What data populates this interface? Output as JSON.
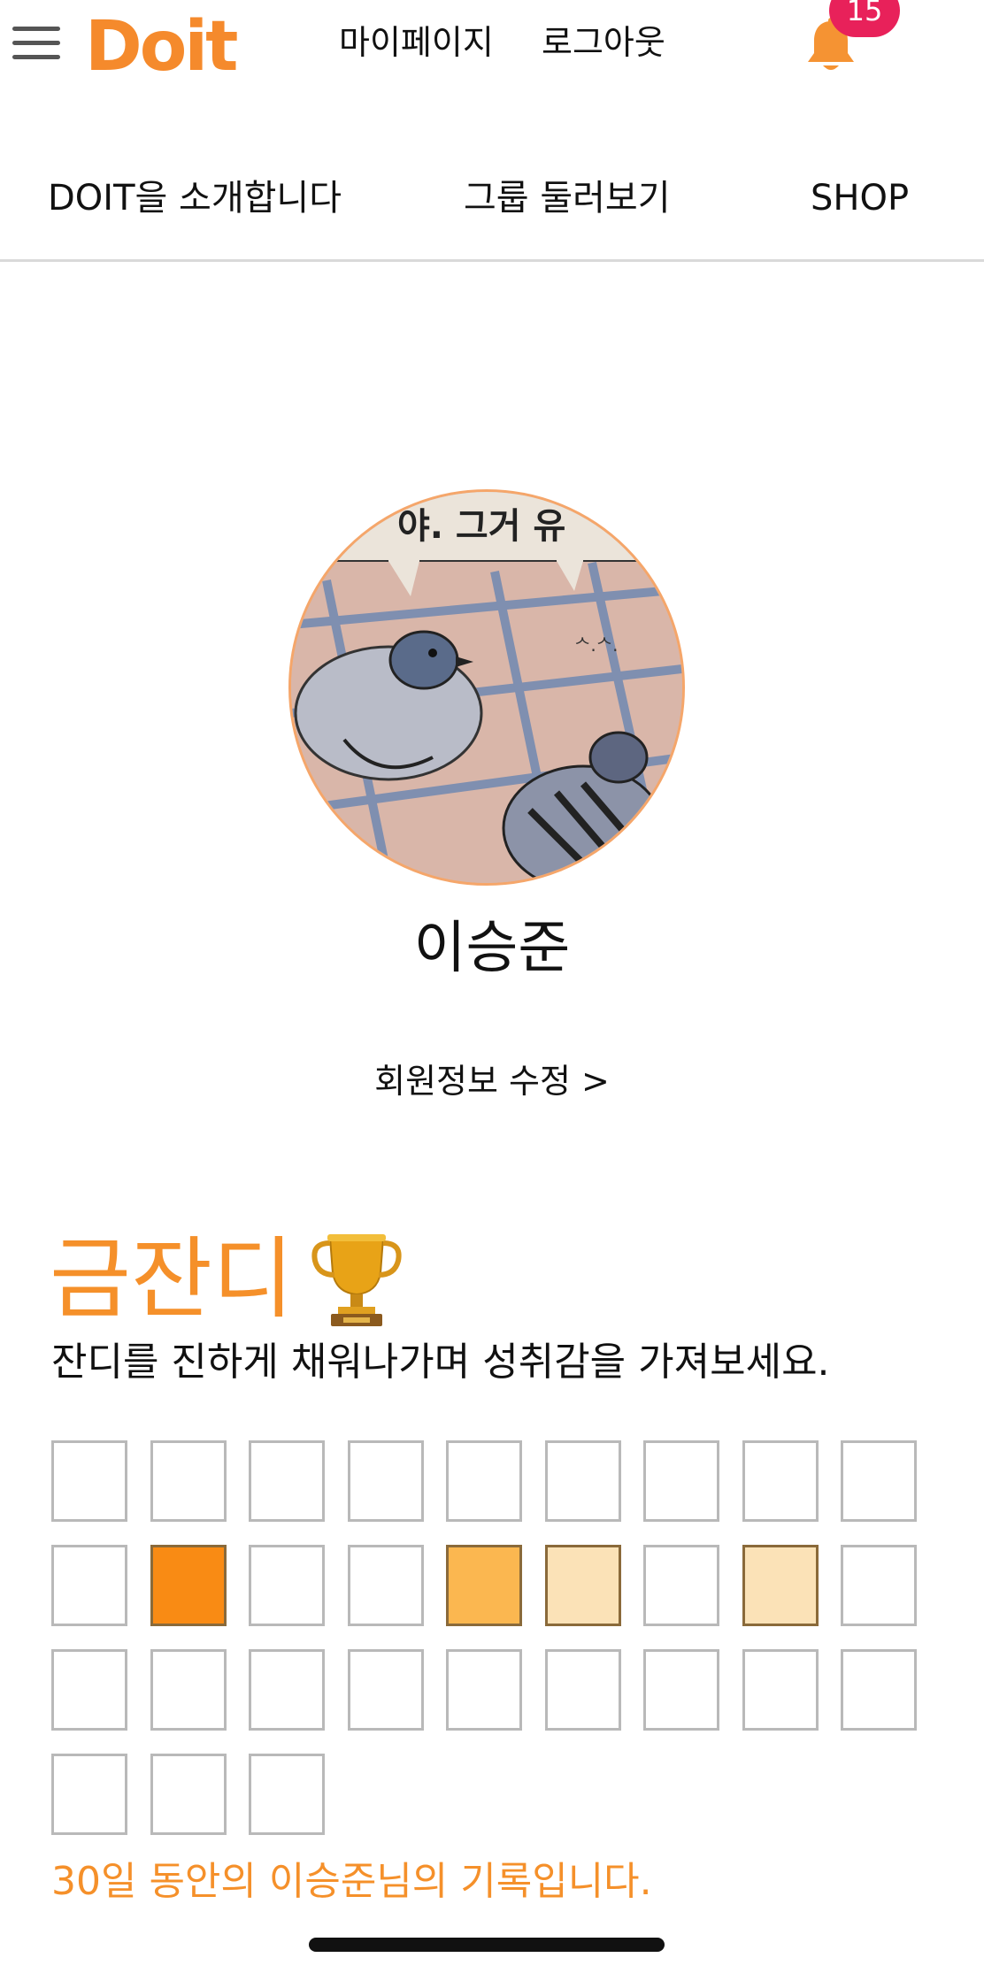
{
  "header": {
    "logo_text": "Doit",
    "my_page_label": "마이페이지",
    "logout_label": "로그아웃",
    "notification_count": "15"
  },
  "nav": {
    "about_label": "DOIT을 소개합니다",
    "groups_label": "그룹 둘러보기",
    "shop_label": "SHOP"
  },
  "profile": {
    "name": "이승준",
    "edit_label": "회원정보 수정 >",
    "avatar_caption": "야. 그거 유"
  },
  "grass": {
    "title": "금잔디",
    "description": "잔디를 진하게 채워나가며 성취감을 가져보세요.",
    "record_text": "30일 동안의 이승준님의 기록입니다.",
    "days": [
      0,
      0,
      0,
      0,
      0,
      0,
      0,
      0,
      0,
      0,
      3,
      0,
      0,
      2,
      1,
      0,
      1,
      0,
      0,
      0,
      0,
      0,
      0,
      0,
      0,
      0,
      0,
      0,
      0,
      0
    ],
    "level_colors": [
      "#ffffff",
      "#FBE2B7",
      "#FBB750",
      "#F98B14"
    ]
  },
  "colors": {
    "brand": "#F58A2C",
    "accent_title": "#F5902A",
    "badge": "#E8215A"
  }
}
